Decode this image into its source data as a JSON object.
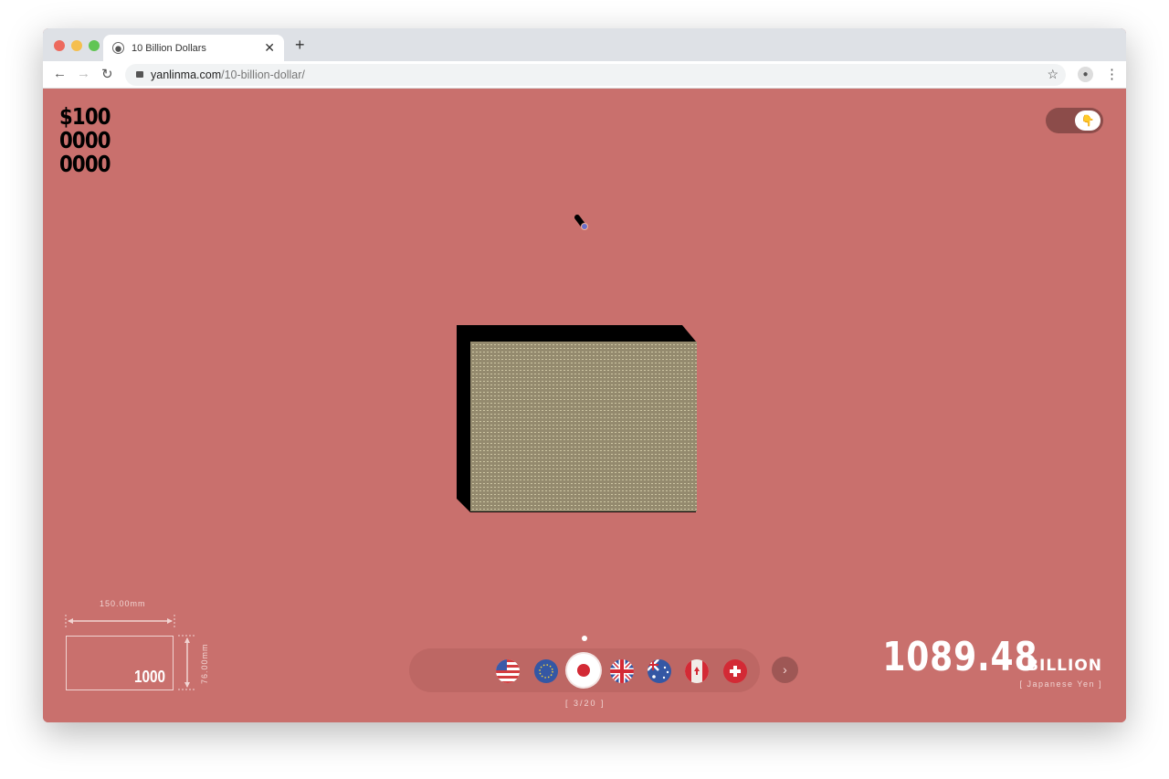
{
  "browser": {
    "tab_title": "10 Billion Dollars",
    "url_host": "yanlinma.com",
    "url_path": "/10-billion-dollar/"
  },
  "headline": {
    "line1": "$100",
    "line2": "0000",
    "line3": "0000"
  },
  "note_dims": {
    "width": "150.00mm",
    "height": "76.00mm",
    "denomination": "1000"
  },
  "currency_selector": {
    "flags": [
      "us-flag",
      "eu-flag",
      "japan-flag",
      "uk-flag",
      "australia-flag",
      "canada-flag",
      "switzerland-flag"
    ],
    "selected_index": 2,
    "counter": "[ 3/20 ]",
    "next_label": "›"
  },
  "total": {
    "value": "1089.48",
    "unit": "BILLION",
    "currency": "[ Japanese Yen ]"
  },
  "toggle": {
    "icon": "👇"
  },
  "colors": {
    "background": "#c9706d",
    "accent": "#8c4c4a"
  }
}
